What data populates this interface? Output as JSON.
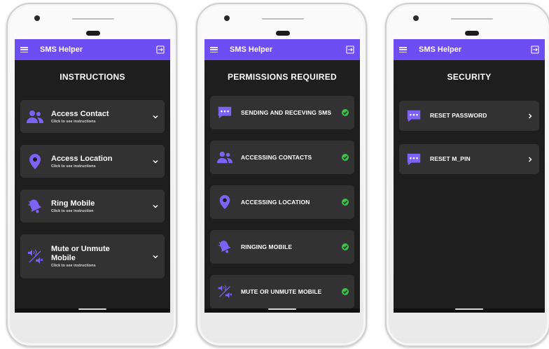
{
  "app": {
    "title": "SMS Helper"
  },
  "colors": {
    "accent": "#6c4ef2",
    "success": "#3dbf4a",
    "card": "#323232",
    "background": "#1e1e1e"
  },
  "screens": [
    {
      "heading": "INSTRUCTIONS",
      "items": [
        {
          "title": "Access Contact",
          "subtitle": "Click to see instructions",
          "icon": "contacts-icon"
        },
        {
          "title": "Access Location",
          "subtitle": "Click to see instructions",
          "icon": "location-icon"
        },
        {
          "title": "Ring Mobile",
          "subtitle": "Click to see instruction",
          "icon": "bell-icon"
        },
        {
          "title_line1": "Mute or Unmute",
          "title_line2": "Mobile",
          "subtitle": "Click to see instructions",
          "icon": "mute-toggle-icon"
        }
      ]
    },
    {
      "heading": "PERMISSIONS REQUIRED",
      "items": [
        {
          "title": "SENDING AND RECEVING SMS",
          "icon": "message-icon"
        },
        {
          "title": "ACCESSING CONTACTS",
          "icon": "contacts-icon"
        },
        {
          "title": "ACCESSING LOCATION",
          "icon": "location-icon"
        },
        {
          "title": "RINGING MOBILE",
          "icon": "bell-icon"
        },
        {
          "title": "MUTE OR UNMUTE MOBILE",
          "icon": "mute-toggle-icon"
        }
      ]
    },
    {
      "heading": "SECURITY",
      "items": [
        {
          "title": "RESET PASSWORD",
          "icon": "message-icon"
        },
        {
          "title": "RESET M_PIN",
          "icon": "message-icon"
        }
      ]
    }
  ]
}
